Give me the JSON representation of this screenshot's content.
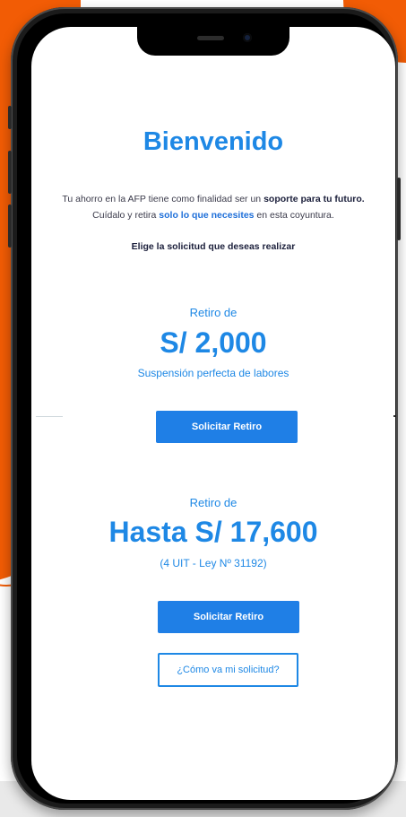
{
  "colors": {
    "accent": "#1e88e5",
    "button_bg": "#1f7fe6",
    "brand_orange": "#f25c05",
    "text_dark": "#1b1f3b"
  },
  "screen": {
    "title": "Bienvenido",
    "intro": {
      "line1_prefix": "Tu ahorro en la AFP tiene como finalidad ser un ",
      "line1_bold": "soporte para tu futuro.",
      "line2_prefix": "Cuídalo y retira ",
      "line2_highlight": "solo lo que necesites",
      "line2_suffix": " en esta coyuntura."
    },
    "prompt": "Elige la solicitud que deseas realizar",
    "option1": {
      "label": "Retiro de",
      "amount": "S/ 2,000",
      "subtitle": "Suspensión perfecta de labores",
      "button": "Solicitar Retiro"
    },
    "option2": {
      "label": "Retiro de",
      "amount": "Hasta S/ 17,600",
      "subtitle": "(4 UIT - Ley Nº 31192)",
      "button": "Solicitar Retiro"
    },
    "status_button": "¿Cómo va mi solicitud?"
  },
  "device": {
    "icons": [
      "speaker-icon",
      "front-camera-icon"
    ]
  }
}
